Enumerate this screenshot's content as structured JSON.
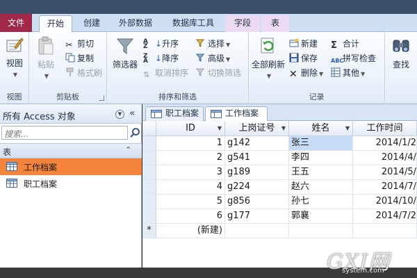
{
  "ribbon_tabs": [
    "文件",
    "开始",
    "创建",
    "外部数据",
    "数据库工具",
    "字段",
    "表"
  ],
  "groups": {
    "view": {
      "label": "视图",
      "button": "视图"
    },
    "clipboard": {
      "label": "剪贴板",
      "paste": "粘贴",
      "cut": "剪切",
      "copy": "复制",
      "format_painter": "格式刷"
    },
    "sort_filter": {
      "label": "排序和筛选",
      "filter": "筛选器",
      "ascending": "升序",
      "descending": "降序",
      "clear_sort": "取消排序",
      "selection": "选择",
      "advanced": "高级",
      "toggle_filter": "切换筛选"
    },
    "records": {
      "label": "记录",
      "refresh_all": "全部刷新",
      "new": "新建",
      "save": "保存",
      "delete": "删除",
      "totals": "合计",
      "spelling": "拼写检查",
      "more": "其他"
    },
    "find": {
      "find": "查找"
    }
  },
  "nav": {
    "title": "所有 Access 对象",
    "search_placeholder": "搜索...",
    "category": "表",
    "items": [
      "工作档案",
      "职工档案"
    ]
  },
  "doc_tabs": [
    "职工档案",
    "工作档案"
  ],
  "table": {
    "columns": [
      "ID",
      "上岗证号",
      "姓名",
      "工作时间"
    ],
    "rows": [
      {
        "id": "1",
        "cert": "g142",
        "name": "张三",
        "date": "2014/1/2"
      },
      {
        "id": "2",
        "cert": "g541",
        "name": "李四",
        "date": "2014/4/"
      },
      {
        "id": "3",
        "cert": "g189",
        "name": "王五",
        "date": "2014/5/"
      },
      {
        "id": "4",
        "cert": "g224",
        "name": "赵六",
        "date": "2014/7/"
      },
      {
        "id": "5",
        "cert": "g856",
        "name": "孙七",
        "date": "2014/10/"
      },
      {
        "id": "6",
        "cert": "g177",
        "name": "郭襄",
        "date": "2014/7/2"
      }
    ],
    "new_row_marker": "*",
    "new_row_label": "(新建)"
  },
  "watermark": {
    "main": "GXI网",
    "sub": "system.com"
  },
  "colors": {
    "file_tab": "#a2284a",
    "selected_nav": "#f4843c",
    "cell_highlight": "#c7dcf6"
  }
}
